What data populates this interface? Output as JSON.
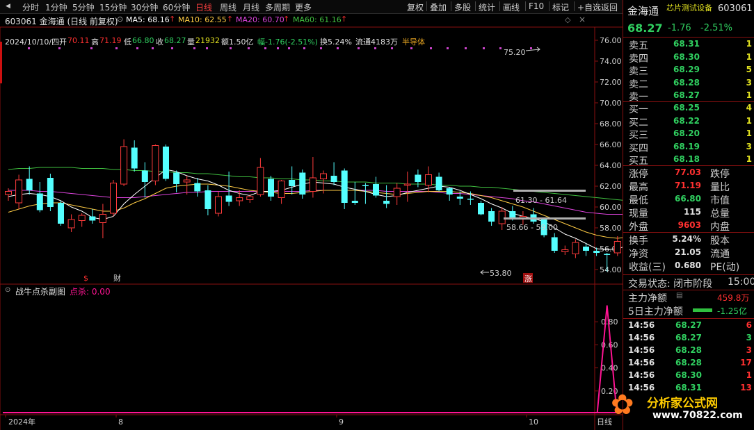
{
  "toolbar": {
    "left": [
      "分时",
      "1分钟",
      "5分钟",
      "15分钟",
      "30分钟",
      "60分钟",
      "日线",
      "周线",
      "月线",
      "多周期",
      "更多"
    ],
    "active": "日线",
    "right": [
      "复权",
      "叠加",
      "多股",
      "统计",
      "画线",
      "F10",
      "标记",
      "+自选",
      "返回"
    ]
  },
  "header": {
    "code_name": "603061 金海通 (日线 前复权)",
    "ma5": "MA5: 68.16",
    "ma10": "MA10: 62.55",
    "ma20": "MA20: 60.70",
    "ma60": "MA60: 61.16"
  },
  "info": {
    "date": "2024/10/10/四",
    "open_label": "开",
    "open": "70.11",
    "high_label": "高",
    "high": "71.19",
    "low_label": "低",
    "low": "66.80",
    "close_label": "收",
    "close": "68.27",
    "vol_label": "量",
    "vol": "21932",
    "amount": "额1.50亿",
    "change": "幅-1.76(-2.51%)",
    "turnover": "换5.24%",
    "float": "流通4183万",
    "sector": "半导体"
  },
  "yaxis": [
    "76.00",
    "74.00",
    "72.00",
    "70.00",
    "68.00",
    "66.00",
    "64.00",
    "62.00",
    "60.00",
    "58.00",
    "56.00",
    "54.00"
  ],
  "annotations": {
    "high_mark": "75.20",
    "low_mark": "53.80",
    "level1": "61.30 - 61.64",
    "level2": "58.66 - 59.00",
    "event_dollar": "$",
    "event_cai": "财",
    "event_zhang": "涨"
  },
  "sub": {
    "title": "战牛点杀副图",
    "label": "点杀: 0.00",
    "yaxis": [
      "0.80",
      "0.60",
      "0.40",
      "0.20"
    ]
  },
  "xaxis": {
    "labels": [
      "2024年",
      "8",
      "9",
      "10"
    ],
    "right_label": "日线"
  },
  "colors": {
    "up": "#ff3b3b",
    "down": "#54ffff",
    "ma5": "#ffffff",
    "ma10": "#ffcc44",
    "ma20": "#dd44dd",
    "ma60": "#40c040",
    "spike": "#ff1493"
  },
  "panel": {
    "name": "金海通",
    "sector_tag": "芯片测试设备",
    "code": "603061",
    "price": "68.27",
    "change": "-1.76",
    "pct": "-2.51%",
    "sells": [
      {
        "label": "卖五",
        "price": "68.31",
        "vol": "1"
      },
      {
        "label": "卖四",
        "price": "68.30",
        "vol": "1"
      },
      {
        "label": "卖三",
        "price": "68.29",
        "vol": "5"
      },
      {
        "label": "卖二",
        "price": "68.28",
        "vol": "3"
      },
      {
        "label": "卖一",
        "price": "68.27",
        "vol": "1"
      }
    ],
    "buys": [
      {
        "label": "买一",
        "price": "68.25",
        "vol": "4"
      },
      {
        "label": "买二",
        "price": "68.22",
        "vol": "1"
      },
      {
        "label": "买三",
        "price": "68.20",
        "vol": "1"
      },
      {
        "label": "买四",
        "price": "68.19",
        "vol": "3"
      },
      {
        "label": "买五",
        "price": "68.18",
        "vol": "1"
      }
    ],
    "stats": [
      {
        "l1": "涨停",
        "v1": "77.03",
        "c1": "red",
        "l2": "跌停"
      },
      {
        "l1": "最高",
        "v1": "71.19",
        "c1": "red",
        "l2": "量比"
      },
      {
        "l1": "最低",
        "v1": "66.80",
        "c1": "green",
        "l2": "市值"
      },
      {
        "l1": "现量",
        "v1": "115",
        "c1": "white",
        "l2": "总量"
      },
      {
        "l1": "外盘",
        "v1": "9603",
        "c1": "red",
        "l2": "内盘"
      }
    ],
    "stats2": [
      {
        "l1": "换手",
        "v1": "5.24%",
        "l2": "股本"
      },
      {
        "l1": "净资",
        "v1": "21.05",
        "l2": "流通"
      },
      {
        "l1": "收益(三)",
        "v1": "0.680",
        "l2": "PE(动)"
      }
    ],
    "status_label": "交易状态: 闭市阶段",
    "status_time": "15:00",
    "main_net_label": "主力净额",
    "main_net_value": "459.8万",
    "main5_label": "5日主力净额",
    "main5_value": "-1.25亿",
    "ticks": [
      {
        "time": "14:56",
        "price": "68.27",
        "vol": "6",
        "dir": "red"
      },
      {
        "time": "14:56",
        "price": "68.27",
        "vol": "3",
        "dir": "green"
      },
      {
        "time": "14:56",
        "price": "68.28",
        "vol": "3",
        "dir": "red"
      },
      {
        "time": "14:56",
        "price": "68.28",
        "vol": "17",
        "dir": "red"
      },
      {
        "time": "14:56",
        "price": "68.30",
        "vol": "1",
        "dir": "red"
      },
      {
        "time": "14:56",
        "price": "68.31",
        "vol": "13",
        "dir": "red"
      }
    ]
  },
  "chart_data": {
    "type": "candlestick",
    "ylim": [
      53,
      77
    ],
    "candles": [
      {
        "o": 61.2,
        "h": 61.8,
        "l": 60.6,
        "c": 61.5
      },
      {
        "o": 60.4,
        "h": 63.1,
        "l": 59.8,
        "c": 62.6
      },
      {
        "o": 62.7,
        "h": 63.9,
        "l": 61.2,
        "c": 61.6
      },
      {
        "o": 61.3,
        "h": 62.4,
        "l": 59.5,
        "c": 59.7
      },
      {
        "o": 62.8,
        "h": 63.2,
        "l": 59.6,
        "c": 60.0
      },
      {
        "o": 60.4,
        "h": 60.6,
        "l": 58.2,
        "c": 58.4
      },
      {
        "o": 58.0,
        "h": 59.3,
        "l": 57.6,
        "c": 58.8
      },
      {
        "o": 58.7,
        "h": 59.4,
        "l": 58.1,
        "c": 59.2
      },
      {
        "o": 59.1,
        "h": 59.8,
        "l": 58.4,
        "c": 58.7
      },
      {
        "o": 58.5,
        "h": 60.3,
        "l": 57.0,
        "c": 59.3
      },
      {
        "o": 59.4,
        "h": 62.6,
        "l": 59.1,
        "c": 62.3
      },
      {
        "o": 62.2,
        "h": 66.5,
        "l": 62.0,
        "c": 65.8
      },
      {
        "o": 65.7,
        "h": 66.4,
        "l": 63.4,
        "c": 63.7
      },
      {
        "o": 63.5,
        "h": 64.3,
        "l": 60.9,
        "c": 62.4
      },
      {
        "o": 62.5,
        "h": 66.0,
        "l": 62.1,
        "c": 65.9
      },
      {
        "o": 65.8,
        "h": 66.0,
        "l": 62.5,
        "c": 62.7
      },
      {
        "o": 63.3,
        "h": 63.5,
        "l": 61.4,
        "c": 62.2
      },
      {
        "o": 62.4,
        "h": 63.0,
        "l": 61.2,
        "c": 62.6
      },
      {
        "o": 62.3,
        "h": 62.8,
        "l": 61.0,
        "c": 61.5
      },
      {
        "o": 61.6,
        "h": 62.1,
        "l": 59.2,
        "c": 59.8
      },
      {
        "o": 59.4,
        "h": 61.5,
        "l": 59.1,
        "c": 61.0
      },
      {
        "o": 61.1,
        "h": 63.4,
        "l": 60.1,
        "c": 60.5
      },
      {
        "o": 60.6,
        "h": 61.6,
        "l": 60.1,
        "c": 60.9
      },
      {
        "o": 60.7,
        "h": 61.2,
        "l": 60.4,
        "c": 61.0
      },
      {
        "o": 61.2,
        "h": 64.7,
        "l": 61.0,
        "c": 63.8
      },
      {
        "o": 62.7,
        "h": 63.0,
        "l": 60.6,
        "c": 61.0
      },
      {
        "o": 60.9,
        "h": 62.6,
        "l": 60.3,
        "c": 62.5
      },
      {
        "o": 62.6,
        "h": 63.9,
        "l": 61.2,
        "c": 62.0
      },
      {
        "o": 63.3,
        "h": 63.6,
        "l": 60.8,
        "c": 61.2
      },
      {
        "o": 61.5,
        "h": 64.8,
        "l": 60.9,
        "c": 62.8
      },
      {
        "o": 62.7,
        "h": 63.5,
        "l": 61.3,
        "c": 63.2
      },
      {
        "o": 63.0,
        "h": 64.3,
        "l": 62.1,
        "c": 62.4
      },
      {
        "o": 63.5,
        "h": 63.7,
        "l": 59.8,
        "c": 60.4
      },
      {
        "o": 60.6,
        "h": 62.4,
        "l": 60.2,
        "c": 60.4
      },
      {
        "o": 62.1,
        "h": 62.3,
        "l": 60.3,
        "c": 62.0
      },
      {
        "o": 62.2,
        "h": 62.9,
        "l": 60.9,
        "c": 61.1
      },
      {
        "o": 60.6,
        "h": 62.1,
        "l": 59.9,
        "c": 60.3
      },
      {
        "o": 61.0,
        "h": 62.3,
        "l": 60.2,
        "c": 61.8
      },
      {
        "o": 62.1,
        "h": 63.4,
        "l": 60.5,
        "c": 62.2
      },
      {
        "o": 63.1,
        "h": 63.6,
        "l": 61.9,
        "c": 62.4
      },
      {
        "o": 62.1,
        "h": 63.9,
        "l": 61.4,
        "c": 63.1
      },
      {
        "o": 62.9,
        "h": 63.3,
        "l": 61.5,
        "c": 61.6
      },
      {
        "o": 61.8,
        "h": 61.9,
        "l": 60.6,
        "c": 61.2
      },
      {
        "o": 61.0,
        "h": 61.5,
        "l": 60.2,
        "c": 60.8
      },
      {
        "o": 60.8,
        "h": 61.5,
        "l": 60.2,
        "c": 60.7
      },
      {
        "o": 60.4,
        "h": 60.6,
        "l": 59.2,
        "c": 59.3
      },
      {
        "o": 59.6,
        "h": 59.9,
        "l": 58.2,
        "c": 58.6
      },
      {
        "o": 58.4,
        "h": 60.0,
        "l": 57.8,
        "c": 59.6
      },
      {
        "o": 59.6,
        "h": 60.1,
        "l": 58.7,
        "c": 58.9
      },
      {
        "o": 58.9,
        "h": 59.6,
        "l": 58.3,
        "c": 59.1
      },
      {
        "o": 59.3,
        "h": 59.9,
        "l": 58.4,
        "c": 58.6
      },
      {
        "o": 58.8,
        "h": 59.0,
        "l": 57.1,
        "c": 57.3
      },
      {
        "o": 57.1,
        "h": 57.5,
        "l": 55.6,
        "c": 55.8
      },
      {
        "o": 55.7,
        "h": 56.3,
        "l": 55.4,
        "c": 55.9
      },
      {
        "o": 55.5,
        "h": 56.9,
        "l": 55.1,
        "c": 56.6
      },
      {
        "o": 56.2,
        "h": 56.5,
        "l": 55.3,
        "c": 55.8
      },
      {
        "o": 55.8,
        "h": 56.1,
        "l": 55.3,
        "c": 55.6
      },
      {
        "o": 55.5,
        "h": 55.6,
        "l": 53.8,
        "c": 55.4
      },
      {
        "o": 55.6,
        "h": 57.2,
        "l": 55.3,
        "c": 56.7
      },
      {
        "o": 56.7,
        "h": 57.4,
        "l": 56.3,
        "c": 57.2
      },
      {
        "o": 57.0,
        "h": 57.6,
        "l": 56.9,
        "c": 57.3
      },
      {
        "o": 57.2,
        "h": 59.2,
        "l": 57.0,
        "c": 58.6
      },
      {
        "o": 58.9,
        "h": 61.6,
        "l": 58.6,
        "c": 61.2
      },
      {
        "o": 63.4,
        "h": 67.3,
        "l": 63.2,
        "c": 67.0
      },
      {
        "o": 72.0,
        "h": 74.0,
        "l": 70.4,
        "c": 70.5
      },
      {
        "o": 74.9,
        "h": 75.2,
        "l": 69.8,
        "c": 70.6
      },
      {
        "o": 70.1,
        "h": 71.2,
        "l": 66.8,
        "c": 68.3
      }
    ],
    "ma5": [
      61.0,
      61.2,
      61.3,
      61.2,
      61.0,
      60.6,
      60.0,
      59.6,
      59.0,
      58.8,
      59.1,
      60.3,
      61.2,
      62.0,
      62.8,
      63.6,
      63.4,
      63.0,
      62.7,
      62.5,
      62.1,
      61.6,
      61.3,
      61.1,
      61.5,
      61.5,
      61.6,
      61.9,
      62.2,
      62.4,
      62.3,
      62.2,
      61.9,
      61.7,
      61.5,
      61.2,
      61.0,
      61.1,
      61.4,
      61.6,
      61.8,
      62.0,
      61.9,
      61.6,
      61.2,
      60.8,
      60.3,
      59.9,
      59.4,
      59.1,
      58.9,
      58.6,
      58.0,
      57.4,
      57.0,
      56.5,
      56.0,
      55.9,
      56.0,
      56.3,
      56.6,
      57.0,
      57.9,
      59.5,
      62.2,
      65.2,
      68.2
    ],
    "ma10": [
      59.5,
      59.8,
      60.1,
      60.3,
      60.4,
      60.4,
      60.2,
      60.0,
      59.8,
      59.6,
      59.6,
      59.9,
      60.4,
      60.8,
      61.3,
      61.8,
      62.0,
      62.1,
      62.2,
      62.2,
      62.1,
      62.0,
      61.8,
      61.6,
      61.5,
      61.4,
      61.3,
      61.3,
      61.4,
      61.5,
      61.6,
      61.6,
      61.6,
      61.6,
      61.5,
      61.4,
      61.3,
      61.2,
      61.3,
      61.4,
      61.5,
      61.5,
      61.5,
      61.4,
      61.3,
      61.1,
      60.9,
      60.6,
      60.3,
      60.0,
      59.6,
      59.2,
      58.8,
      58.4,
      58.0,
      57.6,
      57.3,
      57.1,
      57.0,
      57.1,
      57.3,
      57.6,
      58.1,
      58.8,
      60.0,
      61.4,
      62.5
    ],
    "ma20": [
      61.6,
      61.6,
      61.6,
      61.5,
      61.5,
      61.4,
      61.3,
      61.2,
      61.1,
      61.0,
      60.9,
      60.9,
      60.9,
      61.0,
      61.1,
      61.2,
      61.3,
      61.4,
      61.4,
      61.5,
      61.5,
      61.5,
      61.5,
      61.5,
      61.5,
      61.5,
      61.5,
      61.5,
      61.5,
      61.6,
      61.6,
      61.6,
      61.6,
      61.6,
      61.6,
      61.6,
      61.5,
      61.5,
      61.5,
      61.5,
      61.5,
      61.4,
      61.3,
      61.3,
      61.2,
      61.1,
      61.0,
      60.9,
      60.8,
      60.6,
      60.5,
      60.3,
      60.1,
      59.9,
      59.7,
      59.5,
      59.4,
      59.3,
      59.3,
      59.3,
      59.3,
      59.4,
      59.5,
      59.7,
      60.0,
      60.4,
      60.7
    ],
    "ma60": [
      63.6,
      63.7,
      63.7,
      63.8,
      63.8,
      63.8,
      63.8,
      63.7,
      63.7,
      63.7,
      63.6,
      63.6,
      63.5,
      63.5,
      63.4,
      63.4,
      63.3,
      63.3,
      63.2,
      63.2,
      63.1,
      63.0,
      62.9,
      62.9,
      62.8,
      62.8,
      62.7,
      62.7,
      62.6,
      62.6,
      62.5,
      62.5,
      62.4,
      62.4,
      62.4,
      62.3,
      62.3,
      62.3,
      62.2,
      62.2,
      62.2,
      62.1,
      62.1,
      62.0,
      62.0,
      61.9,
      61.9,
      61.8,
      61.7,
      61.6,
      61.5,
      61.4,
      61.3,
      61.2,
      61.1,
      61.0,
      60.9,
      60.8,
      60.7,
      60.6,
      60.6,
      60.6,
      60.7,
      60.8,
      60.9,
      61.0,
      61.2
    ],
    "sub_spike_index": 57,
    "sub_spike_value": 0.87,
    "sub_ylim": [
      0,
      1
    ]
  }
}
